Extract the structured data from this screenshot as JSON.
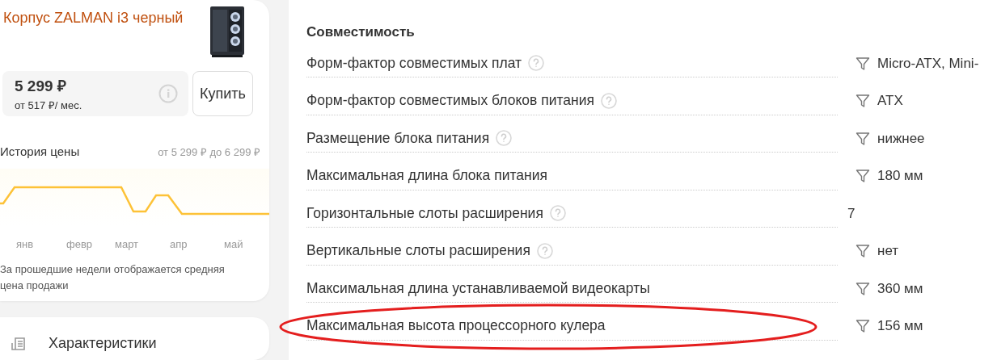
{
  "product": {
    "title": "Корпус ZALMAN i3 черный",
    "price": "5 299 ₽",
    "installment": "от 517 ₽/ мес.",
    "buy_button": "Купить"
  },
  "price_history": {
    "title": "История цены",
    "range": "от 5 299 ₽ до 6 299 ₽",
    "months": [
      "янв",
      "февр",
      "март",
      "апр",
      "май"
    ],
    "note": "За прошедшие недели отображается средняя цена продажи"
  },
  "next_section": {
    "title": "Характеристики"
  },
  "specs": {
    "section_title": "Совместимость",
    "rows": [
      {
        "label": "Форм-фактор совместимых плат",
        "help": true,
        "filter": true,
        "value": "Micro-ATX, Mini-",
        "circled": false
      },
      {
        "label": "Форм-фактор совместимых блоков питания",
        "help": true,
        "filter": true,
        "value": "ATX",
        "circled": false
      },
      {
        "label": "Размещение блока питания",
        "help": true,
        "filter": true,
        "value": "нижнее",
        "circled": false
      },
      {
        "label": "Максимальная длина блока питания",
        "help": false,
        "filter": true,
        "value": "180 мм",
        "circled": false
      },
      {
        "label": "Горизонтальные слоты расширения",
        "help": true,
        "filter": false,
        "value": "7",
        "circled": false
      },
      {
        "label": "Вертикальные слоты расширения",
        "help": true,
        "filter": true,
        "value": "нет",
        "circled": false
      },
      {
        "label": "Максимальная длина устанавливаемой видеокарты",
        "help": false,
        "filter": true,
        "value": "360 мм",
        "circled": false
      },
      {
        "label": "Максимальная высота процессорного кулера",
        "help": false,
        "filter": true,
        "value": "156 мм",
        "circled": true
      }
    ]
  }
}
